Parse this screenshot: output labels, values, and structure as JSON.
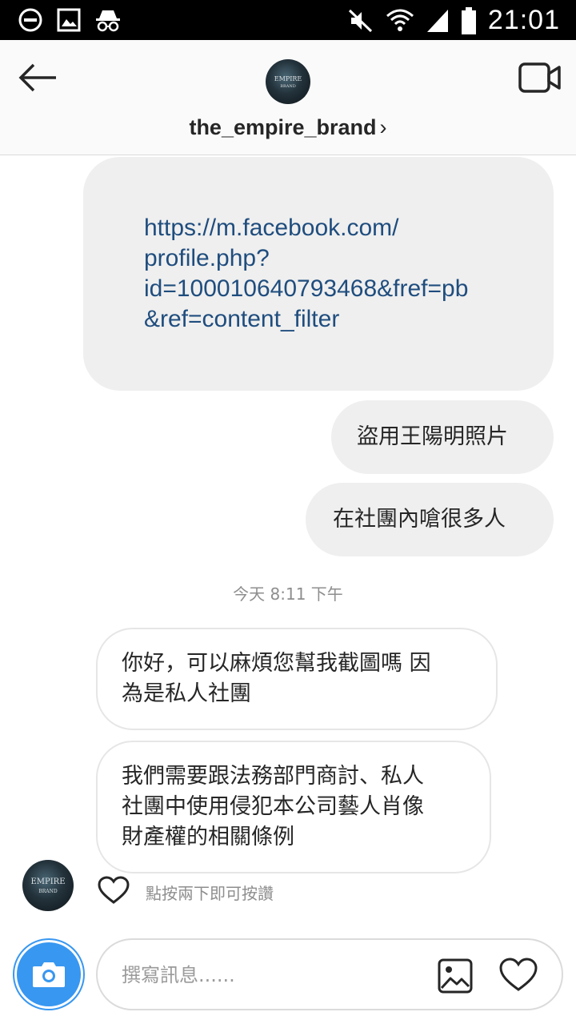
{
  "status_bar": {
    "time": "21:01",
    "icons": [
      "dnd-icon",
      "gallery-notification-icon",
      "incognito-icon",
      "mute-icon",
      "wifi-icon",
      "signal-icon",
      "battery-icon"
    ]
  },
  "header": {
    "username": "the_empire_brand",
    "chevron": "›",
    "avatar_text_line1": "EMPIRE",
    "avatar_text_line2": "BRAND",
    "icons": [
      "back-arrow-icon",
      "video-call-icon"
    ]
  },
  "messages": [
    {
      "direction": "outgoing",
      "type": "link",
      "lines": [
        "https://m.facebook.com/",
        "profile.php?",
        "id=100010640793468&fref=pb",
        "&ref=content_filter"
      ]
    },
    {
      "direction": "outgoing",
      "text": "盜用王陽明照片"
    },
    {
      "direction": "outgoing",
      "text": "在社團內嗆很多人"
    },
    {
      "type": "timestamp",
      "text": "今天 8:11 下午"
    },
    {
      "direction": "incoming",
      "lines": [
        "你好，可以麻煩您幫我截圖嗎 因",
        "為是私人社團"
      ]
    },
    {
      "direction": "incoming",
      "lines": [
        "我們需要跟法務部門商討、私人",
        "社團中使用侵犯本公司藝人肖像",
        "財產權的相關條例"
      ]
    }
  ],
  "like_hint": "點按兩下即可按讚",
  "composer": {
    "placeholder": "撰寫訊息......",
    "value": ""
  },
  "colors": {
    "accent": "#3897f0",
    "link": "#1f4d7e",
    "outgoing_bubble": "#efefef",
    "incoming_border": "#e6e6e6",
    "muted_text": "#8e8e8e"
  }
}
